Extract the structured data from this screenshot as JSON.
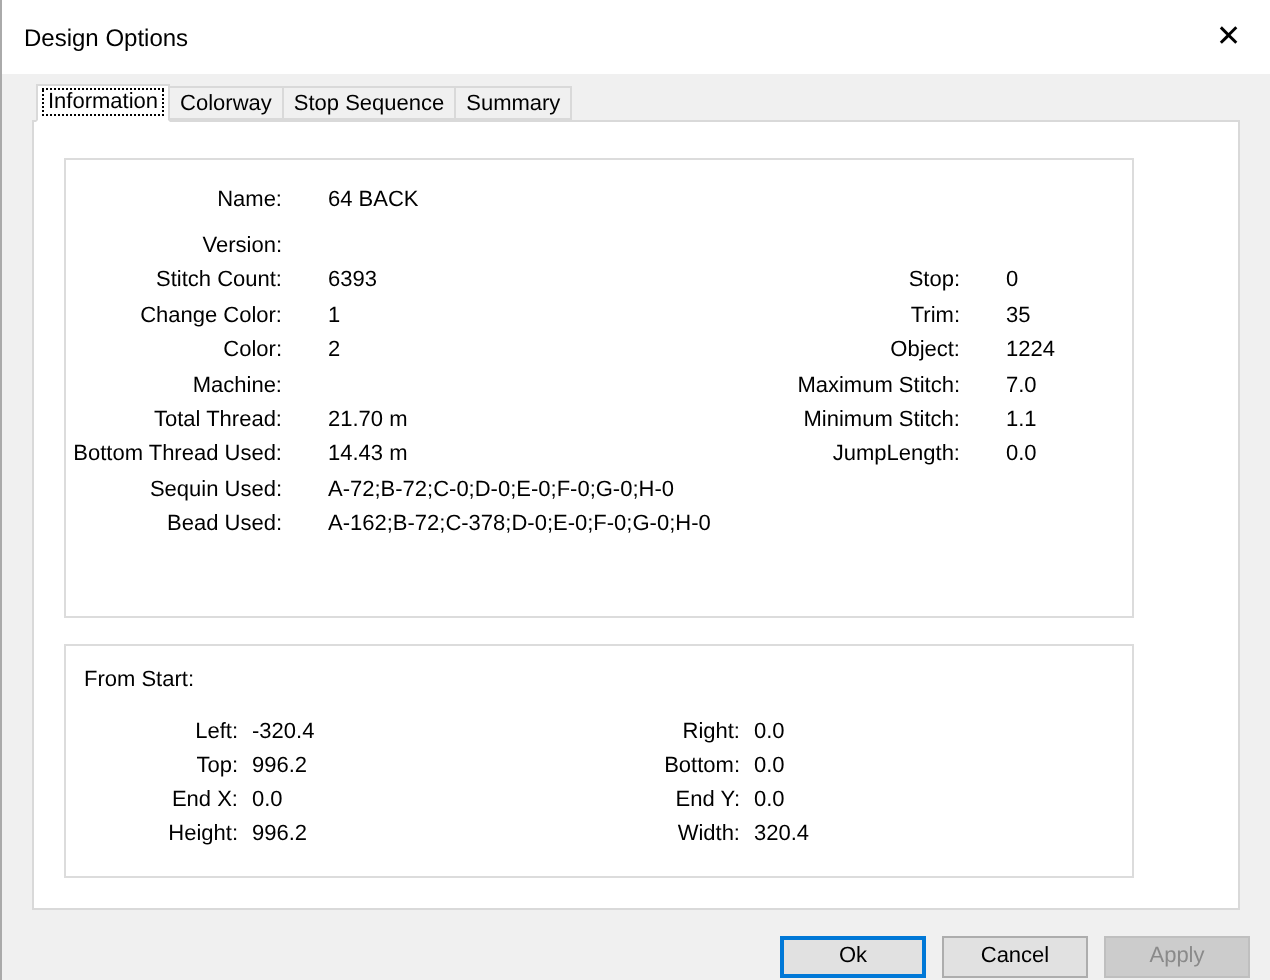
{
  "window": {
    "title": "Design Options",
    "close": "✕"
  },
  "tabs": [
    {
      "label": "Information",
      "selected": true
    },
    {
      "label": "Colorway",
      "selected": false
    },
    {
      "label": "Stop Sequence",
      "selected": false
    },
    {
      "label": "Summary",
      "selected": false
    }
  ],
  "info": {
    "rows": [
      {
        "left": {
          "label": "Name:",
          "value": "64 BACK"
        }
      },
      {
        "left": {
          "label": "Version:"
        }
      },
      {
        "left": {
          "label": "Stitch Count:",
          "value": "6393"
        },
        "right": {
          "label": "Stop:",
          "value": "0"
        }
      },
      {
        "left": {
          "label": "Change Color:",
          "value": "1"
        },
        "right": {
          "label": "Trim:",
          "value": "35"
        }
      },
      {
        "left": {
          "label": "Color:",
          "value": "2"
        },
        "right": {
          "label": "Object:",
          "value": "1224"
        }
      },
      {
        "left": {
          "label": "Machine:"
        },
        "right": {
          "label": "Maximum Stitch:",
          "value": "7.0"
        }
      },
      {
        "left": {
          "label": "Total Thread:",
          "value": "21.70 m"
        },
        "right": {
          "label": "Minimum Stitch:",
          "value": "1.1"
        }
      },
      {
        "left": {
          "label": "Bottom Thread Used:",
          "value": "14.43 m"
        },
        "right": {
          "label": "JumpLength:",
          "value": "0.0"
        }
      },
      {
        "left": {
          "label": "Sequin Used:",
          "value": "A-72;B-72;C-0;D-0;E-0;F-0;G-0;H-0"
        }
      },
      {
        "left": {
          "label": "Bead Used:",
          "value": "A-162;B-72;C-378;D-0;E-0;F-0;G-0;H-0"
        }
      }
    ]
  },
  "from_start": {
    "title": "From Start:",
    "rows": [
      {
        "left": {
          "label": "Left:",
          "value": "-320.4"
        },
        "right": {
          "label": "Right:",
          "value": "0.0"
        }
      },
      {
        "left": {
          "label": "Top:",
          "value": "996.2"
        },
        "right": {
          "label": "Bottom:",
          "value": "0.0"
        }
      },
      {
        "left": {
          "label": "End X:",
          "value": "0.0"
        },
        "right": {
          "label": "End Y:",
          "value": "0.0"
        }
      },
      {
        "left": {
          "label": "Height:",
          "value": "996.2"
        },
        "right": {
          "label": "Width:",
          "value": "320.4"
        }
      }
    ]
  },
  "buttons": [
    {
      "label": "Ok",
      "kind": "default",
      "disabled": false
    },
    {
      "label": "Cancel",
      "kind": "normal",
      "disabled": false
    },
    {
      "label": "Apply",
      "kind": "normal",
      "disabled": true
    }
  ]
}
